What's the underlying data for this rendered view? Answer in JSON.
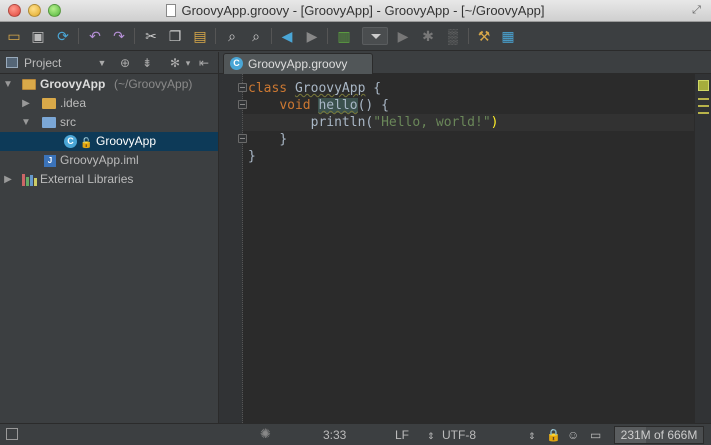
{
  "window": {
    "title": "GroovyApp.groovy - [GroovyApp] - GroovyApp - [~/GroovyApp]"
  },
  "toolbar": {
    "icons": [
      "folder-open-icon",
      "save-icon",
      "sync-icon",
      "undo-icon",
      "redo-icon",
      "cut-icon",
      "copy-icon",
      "paste-icon",
      "find-icon",
      "find-replace-icon",
      "back-icon",
      "forward-icon",
      "build-icon",
      "run-config-dropdown",
      "run-icon",
      "debug-icon",
      "coverage-icon",
      "settings-icon",
      "project-structure-icon"
    ]
  },
  "project_panel": {
    "title": "Project",
    "tree": [
      {
        "label": "GroovyApp",
        "suffix": "(~/GroovyApp)",
        "expanded": true,
        "icon": "module-folder-icon"
      },
      {
        "label": ".idea",
        "expanded": false,
        "icon": "folder-icon"
      },
      {
        "label": "src",
        "expanded": true,
        "icon": "source-folder-icon"
      },
      {
        "label": "GroovyApp",
        "selected": true,
        "icon": "groovy-class-icon"
      },
      {
        "label": "GroovyApp.iml",
        "icon": "iml-file-icon"
      },
      {
        "label": "External Libraries",
        "expanded": false,
        "icon": "libraries-icon"
      }
    ]
  },
  "editor": {
    "tab_label": "GroovyApp.groovy",
    "code": {
      "l1_kw": "class",
      "l1_name": "GroovyApp",
      "l1_brace": " {",
      "l2_kw": "void",
      "l2_name": "hello",
      "l2_rest": "() {",
      "l3_call": "println(",
      "l3_str": "\"Hello, world!\"",
      "l3_close": ")",
      "l4": "}",
      "l5": "}"
    }
  },
  "statusbar": {
    "position": "3:33",
    "line_separator": "LF",
    "encoding": "UTF-8",
    "memory": "231M of 666M",
    "memory_used_fraction": 0.347
  },
  "colors": {
    "keyword": "#cc7832",
    "string": "#6a8759",
    "selection": "#0d3a58",
    "editor_bg": "#2b2b2b"
  }
}
